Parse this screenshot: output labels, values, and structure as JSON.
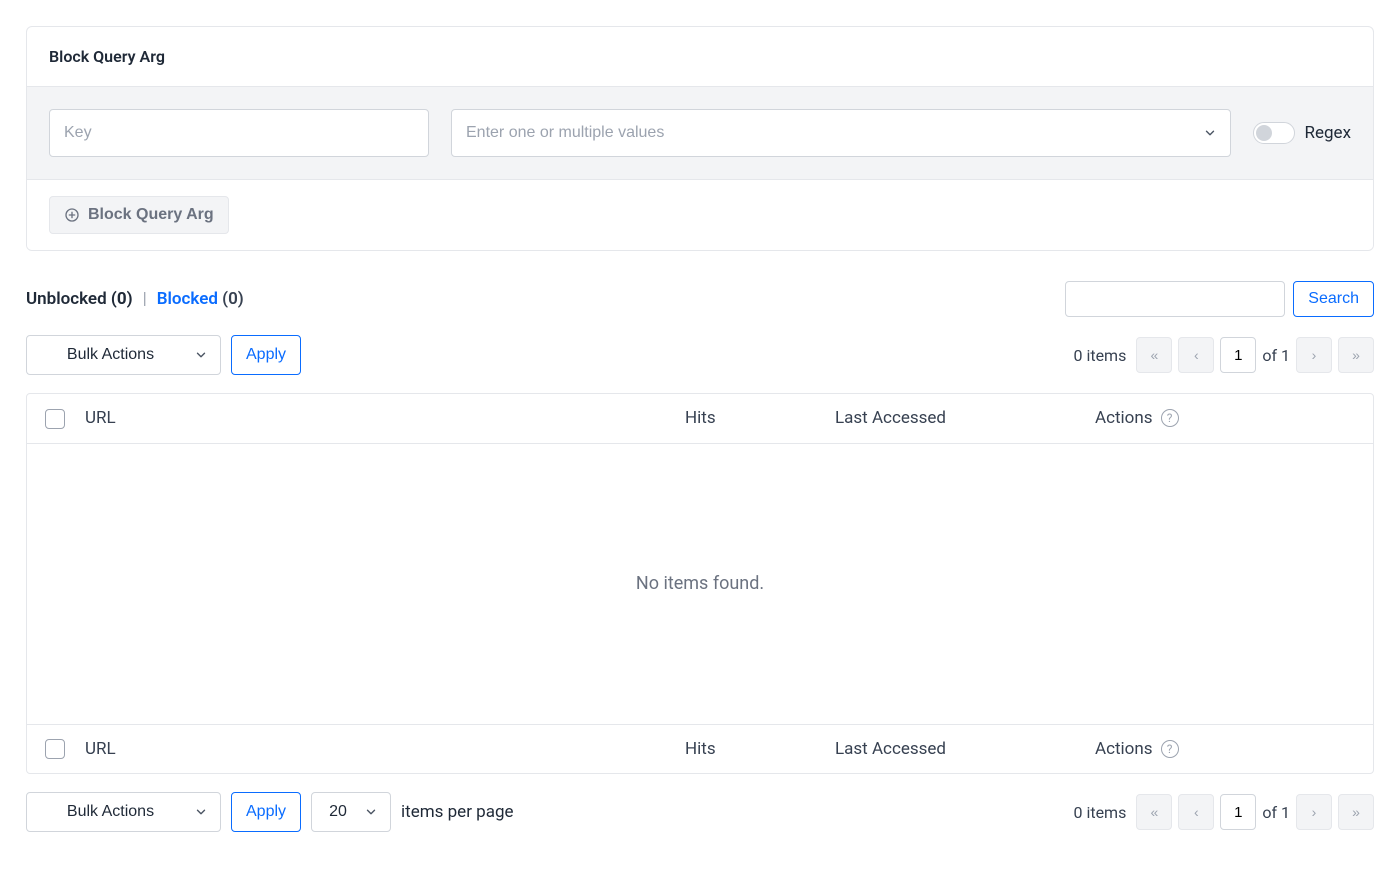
{
  "card": {
    "title": "Block Query Arg",
    "key_placeholder": "Key",
    "values_placeholder": "Enter one or multiple values",
    "regex_label": "Regex",
    "add_button": "Block Query Arg"
  },
  "tabs": {
    "unblocked": {
      "label": "Unblocked",
      "count": "(0)"
    },
    "blocked": {
      "label": "Blocked",
      "count": "(0)"
    },
    "separator": "|"
  },
  "search_button": "Search",
  "bulk_actions_label": "Bulk Actions",
  "apply_label": "Apply",
  "pagination": {
    "items_text": "0 items",
    "page_value": "1",
    "of_label": "of 1"
  },
  "table": {
    "col_url": "URL",
    "col_hits": "Hits",
    "col_last": "Last Accessed",
    "col_actions": "Actions",
    "empty_text": "No items found."
  },
  "footer": {
    "per_page_value": "20",
    "per_page_label": "items per page"
  }
}
